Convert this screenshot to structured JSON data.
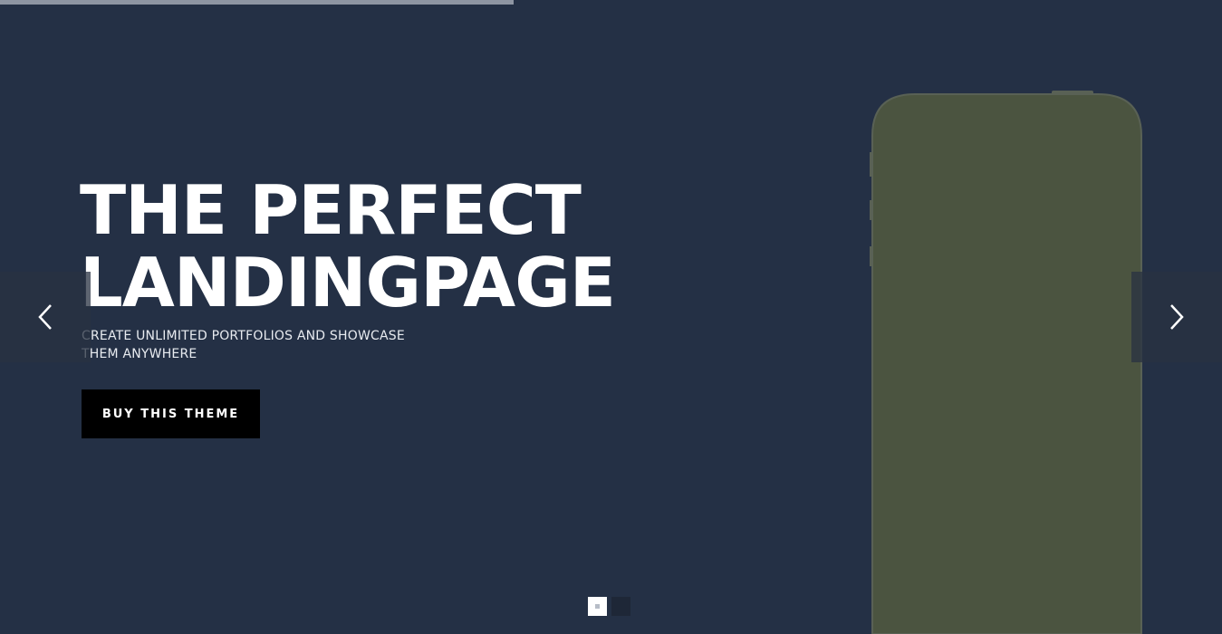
{
  "slider": {
    "progress": 0.42,
    "title_line1": "THE PERFECT",
    "title_line2": "LANDINGPAGE",
    "subtitle_line1": "CREATE UNLIMITED PORTFOLIOS AND SHOWCASE",
    "subtitle_line2": "THEM ANYWHERE",
    "cta_label": "BUY THIS THEME",
    "prev_icon": "chevron-left-icon",
    "next_icon": "chevron-right-icon",
    "slide_count": 2,
    "active_slide": 1
  },
  "colors": {
    "background": "#243045",
    "progress_bar": "#8e95a2",
    "phone_body": "#4b5440",
    "phone_edge": "#596155",
    "button_bg": "#000000",
    "text": "#ffffff"
  }
}
